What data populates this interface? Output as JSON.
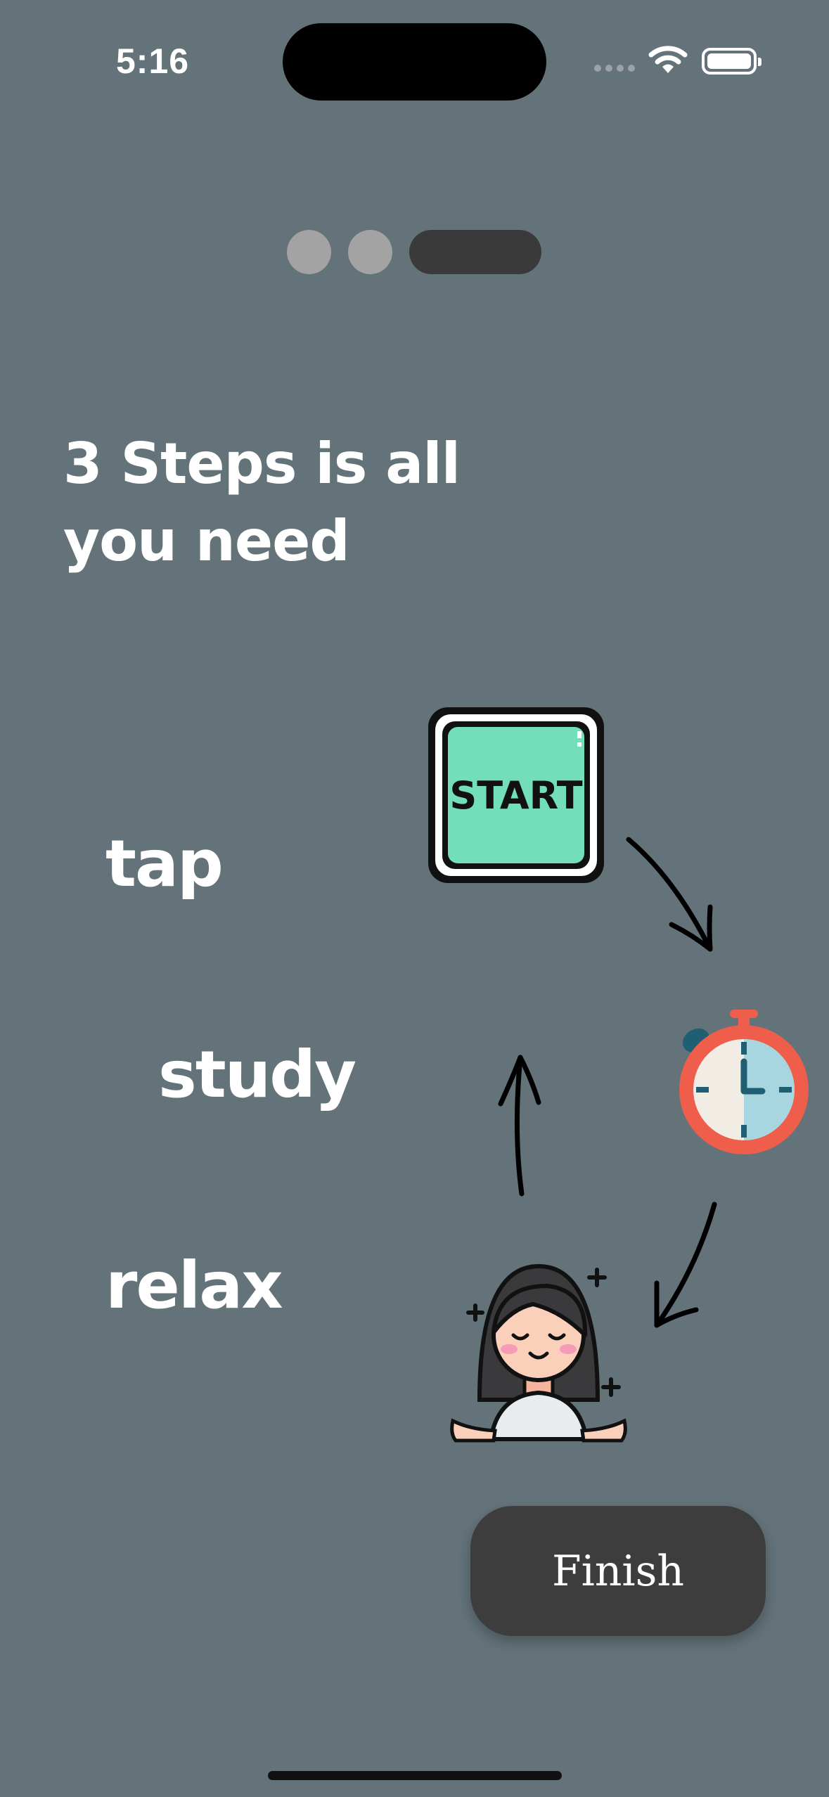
{
  "status_bar": {
    "time": "5:16"
  },
  "page_indicator": {
    "total": 3,
    "current": 3
  },
  "onboarding": {
    "title": "3 Steps is all you need",
    "steps": [
      "tap",
      "study",
      "relax"
    ],
    "start_icon_text": "START"
  },
  "actions": {
    "finish_label": "Finish"
  }
}
